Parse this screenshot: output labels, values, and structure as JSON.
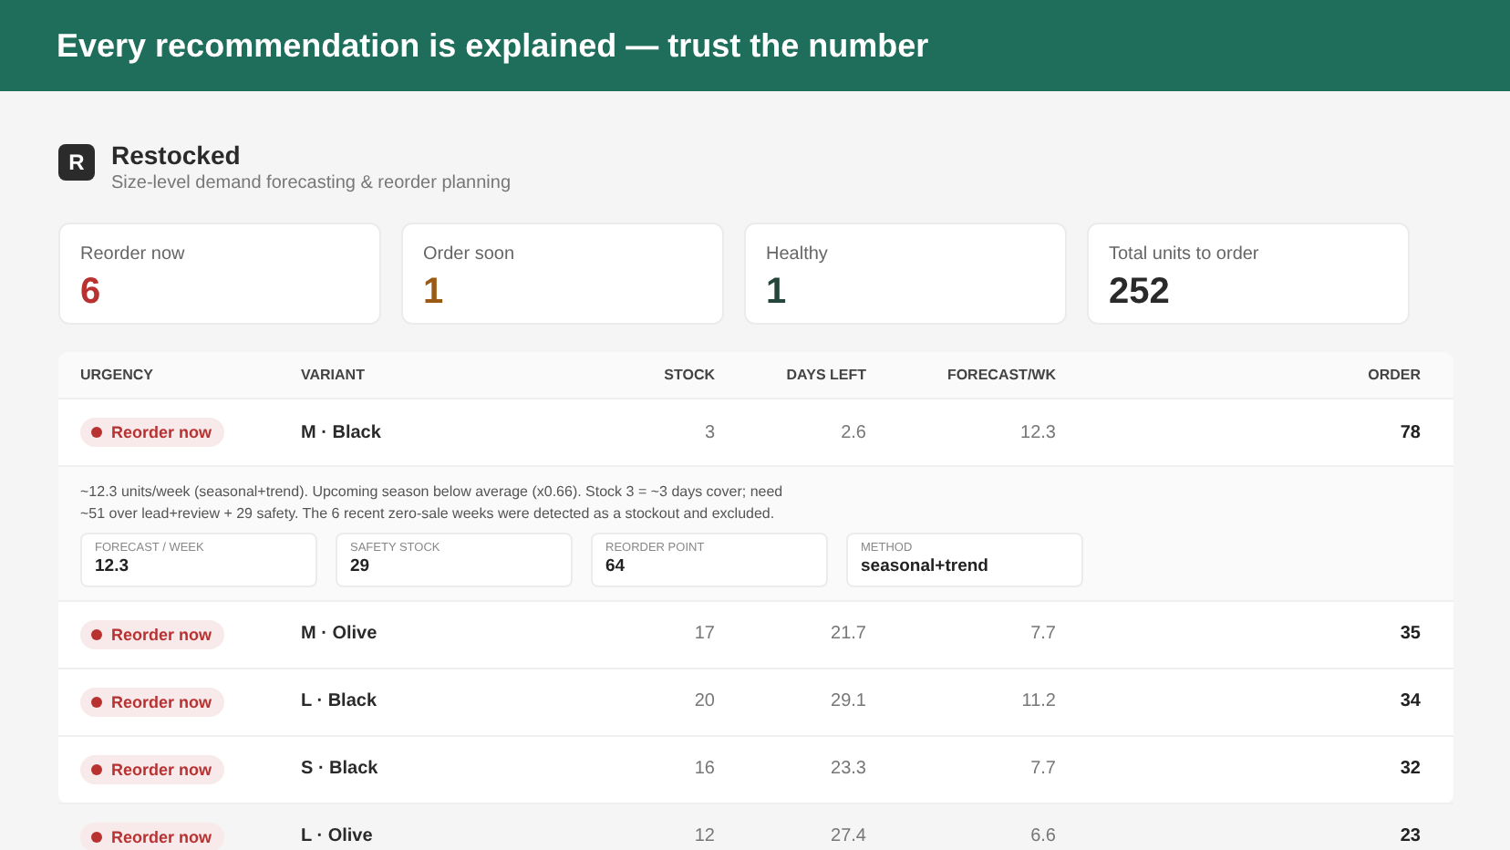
{
  "banner": {
    "title": "Every recommendation is explained — trust the number"
  },
  "app": {
    "logo": "R",
    "name": "Restocked",
    "tagline": "Size-level demand forecasting & reorder planning"
  },
  "stats": [
    {
      "label": "Reorder now",
      "value": "6",
      "kind": "danger"
    },
    {
      "label": "Order soon",
      "value": "1",
      "kind": "warning"
    },
    {
      "label": "Healthy",
      "value": "1",
      "kind": "healthy"
    },
    {
      "label": "Total units to order",
      "value": "252",
      "kind": "neutral"
    }
  ],
  "table": {
    "columns": [
      "URGENCY",
      "VARIANT",
      "STOCK",
      "DAYS LEFT",
      "FORECAST/WK",
      "ORDER"
    ],
    "rows": [
      {
        "urgency": {
          "label": "Reorder now",
          "kind": "danger"
        },
        "variant": "M · Black",
        "stock": "3",
        "days_left": "2.6",
        "forecast": "12.3",
        "order": "78",
        "detail": {
          "text": "~12.3 units/week (seasonal+trend). Upcoming season below average (x0.66). Stock 3 = ~3 days cover; need ~51 over lead+review + 29 safety. The 6 recent zero-sale weeks were detected as a stockout and excluded.",
          "metrics": [
            {
              "label": "FORECAST / WEEK",
              "value": "12.3"
            },
            {
              "label": "SAFETY STOCK",
              "value": "29"
            },
            {
              "label": "REORDER POINT",
              "value": "64"
            },
            {
              "label": "METHOD",
              "value": "seasonal+trend"
            }
          ]
        }
      },
      {
        "urgency": {
          "label": "Reorder now",
          "kind": "danger"
        },
        "variant": "M · Olive",
        "stock": "17",
        "days_left": "21.7",
        "forecast": "7.7",
        "order": "35"
      },
      {
        "urgency": {
          "label": "Reorder now",
          "kind": "danger"
        },
        "variant": "L · Black",
        "stock": "20",
        "days_left": "29.1",
        "forecast": "11.2",
        "order": "34"
      },
      {
        "urgency": {
          "label": "Reorder now",
          "kind": "danger"
        },
        "variant": "S · Black",
        "stock": "16",
        "days_left": "23.3",
        "forecast": "7.7",
        "order": "32"
      },
      {
        "urgency": {
          "label": "Reorder now",
          "kind": "danger"
        },
        "variant": "L · Olive",
        "stock": "12",
        "days_left": "27.4",
        "forecast": "6.6",
        "order": "23"
      }
    ]
  }
}
